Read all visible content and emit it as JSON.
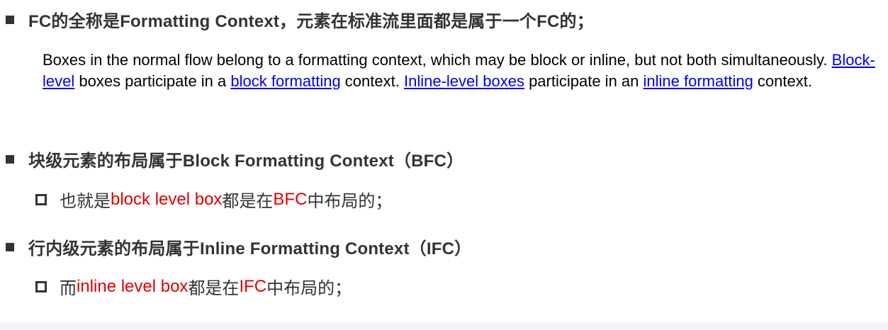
{
  "heading1": "FC的全称是Formatting Context，元素在标准流里面都是属于一个FC的；",
  "quote": {
    "part1": "Boxes in the normal flow belong to a formatting context, which may be block or inline, but not both simultaneously. ",
    "link1": "Block-level",
    "part2": " boxes participate in a ",
    "link2": "block formatting",
    "part3": " context. ",
    "link3": "Inline-level boxes",
    "part4": " participate in an ",
    "link4": "inline formatting",
    "part5": " context."
  },
  "heading2": "块级元素的布局属于Block Formatting Context（BFC）",
  "sub1": {
    "pre": "也就是",
    "red1": "block level box",
    "mid": "都是在",
    "red2": "BFC",
    "post": "中布局的；"
  },
  "heading3": "行内级元素的布局属于Inline Formatting Context（IFC）",
  "sub2": {
    "pre": "而",
    "red1": "inline level box",
    "mid": "都是在",
    "red2": "IFC",
    "post": "中布局的；"
  },
  "colors": {
    "text": "#333333",
    "highlight": "#e00000",
    "link": "#0000ee"
  }
}
